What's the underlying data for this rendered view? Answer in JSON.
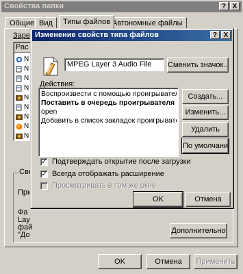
{
  "outer": {
    "title": "Свойства папки",
    "help_btn": "?",
    "close_btn": "X",
    "tabs": [
      "Общие",
      "Вид",
      "Типы файлов",
      "Автономные файлы"
    ],
    "partial_label": "Зарег",
    "partial_col": "Рас",
    "group_partial": "Све",
    "partial_lines": [
      "При",
      "Фа",
      "Lay",
      "фай",
      "\"До"
    ],
    "advanced_button": "Дополнительно",
    "ok": "OK",
    "cancel": "Отмена",
    "apply": "Применить"
  },
  "inner": {
    "title": "Изменение свойств типа файлов",
    "help_btn": "?",
    "close_btn": "X",
    "filetype_name": "MPEG Layer 3 Audio File",
    "change_icon_button": "Сменить значок...",
    "actions_label": "Действия:",
    "actions": [
      {
        "label": "Воспроизвести с помощью проигрывателя Wi",
        "bold": false
      },
      {
        "label": "Поставить в очередь проигрывателя W",
        "bold": true
      },
      {
        "label": "open",
        "bold": false
      },
      {
        "label": "Добавить в список закладок проигрывателя",
        "bold": false
      }
    ],
    "buttons": {
      "create": "Создать...",
      "edit": "Изменить...",
      "delete": "Удалить",
      "default": "По умолчанию"
    },
    "checkboxes": [
      {
        "label": "Подтверждать открытие после загрузки",
        "checked": true,
        "disabled": false
      },
      {
        "label": "Всегда отображать расширение",
        "checked": true,
        "disabled": false
      },
      {
        "label": "Просматривать в том же окне",
        "checked": false,
        "disabled": true
      }
    ],
    "ok": "OK",
    "cancel": "Отмена"
  },
  "colors": {
    "face": "#d4d0c8",
    "active_title": "#0a246a",
    "inactive_title": "#808080"
  }
}
